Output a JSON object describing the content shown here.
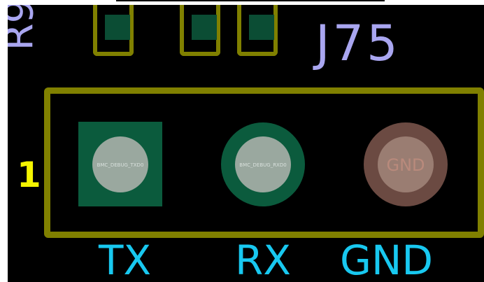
{
  "designator": "J75",
  "partial_designator": "R9",
  "pin1_marker": "1",
  "pins": [
    {
      "net": "BMC_DEBUG_TXD0",
      "label": "TX"
    },
    {
      "net": "BMC_DEBUG_RXD0",
      "label": "RX"
    },
    {
      "net": "GND",
      "label": "GND"
    }
  ],
  "colors": {
    "background": "#000000",
    "courtyard": "#808000",
    "copper_pad": "#0b5b3d",
    "gnd_pad": "#6b4a42",
    "drill_hole": "#9aa89f",
    "designator_silk": "#a9a6f0",
    "pin_labels": "#18c8f0",
    "pin1_marker": "#f5f500"
  }
}
